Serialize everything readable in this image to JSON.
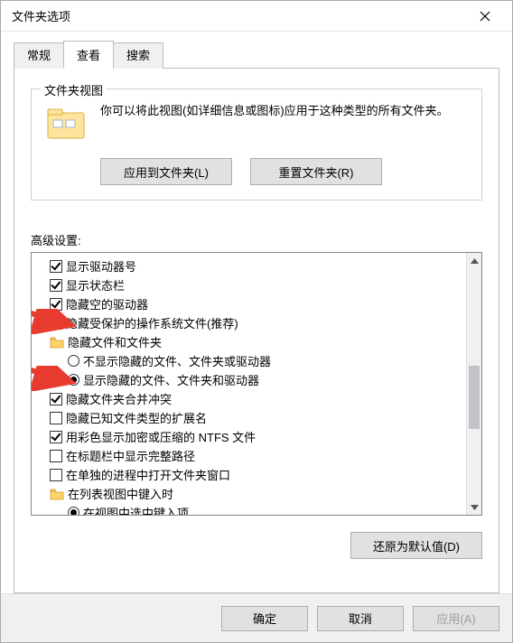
{
  "window": {
    "title": "文件夹选项"
  },
  "tabs": {
    "general": "常规",
    "view": "查看",
    "search": "搜索"
  },
  "group": {
    "label": "文件夹视图",
    "desc": "你可以将此视图(如详细信息或图标)应用于这种类型的所有文件夹。",
    "apply_btn": "应用到文件夹(L)",
    "reset_btn": "重置文件夹(R)"
  },
  "advanced_label": "高级设置:",
  "items": [
    {
      "kind": "checkbox",
      "checked": true,
      "indent": 1,
      "label": "显示驱动器号"
    },
    {
      "kind": "checkbox",
      "checked": true,
      "indent": 1,
      "label": "显示状态栏"
    },
    {
      "kind": "checkbox",
      "checked": true,
      "indent": 1,
      "label": "隐藏空的驱动器"
    },
    {
      "kind": "checkbox",
      "checked": false,
      "indent": 1,
      "label": "隐藏受保护的操作系统文件(推荐)"
    },
    {
      "kind": "folder",
      "indent": 1,
      "label": "隐藏文件和文件夹"
    },
    {
      "kind": "radio",
      "checked": false,
      "indent": 2,
      "label": "不显示隐藏的文件、文件夹或驱动器"
    },
    {
      "kind": "radio",
      "checked": true,
      "indent": 2,
      "label": "显示隐藏的文件、文件夹和驱动器"
    },
    {
      "kind": "checkbox",
      "checked": true,
      "indent": 1,
      "label": "隐藏文件夹合并冲突"
    },
    {
      "kind": "checkbox",
      "checked": false,
      "indent": 1,
      "label": "隐藏已知文件类型的扩展名"
    },
    {
      "kind": "checkbox",
      "checked": true,
      "indent": 1,
      "label": "用彩色显示加密或压缩的 NTFS 文件"
    },
    {
      "kind": "checkbox",
      "checked": false,
      "indent": 1,
      "label": "在标题栏中显示完整路径"
    },
    {
      "kind": "checkbox",
      "checked": false,
      "indent": 1,
      "label": "在单独的进程中打开文件夹窗口"
    },
    {
      "kind": "folder",
      "indent": 1,
      "label": "在列表视图中键入时"
    },
    {
      "kind": "radio",
      "checked": true,
      "indent": 2,
      "label": "在视图中选中键入项"
    }
  ],
  "restore_btn": "还原为默认值(D)",
  "footer": {
    "ok": "确定",
    "cancel": "取消",
    "apply": "应用(A)"
  }
}
